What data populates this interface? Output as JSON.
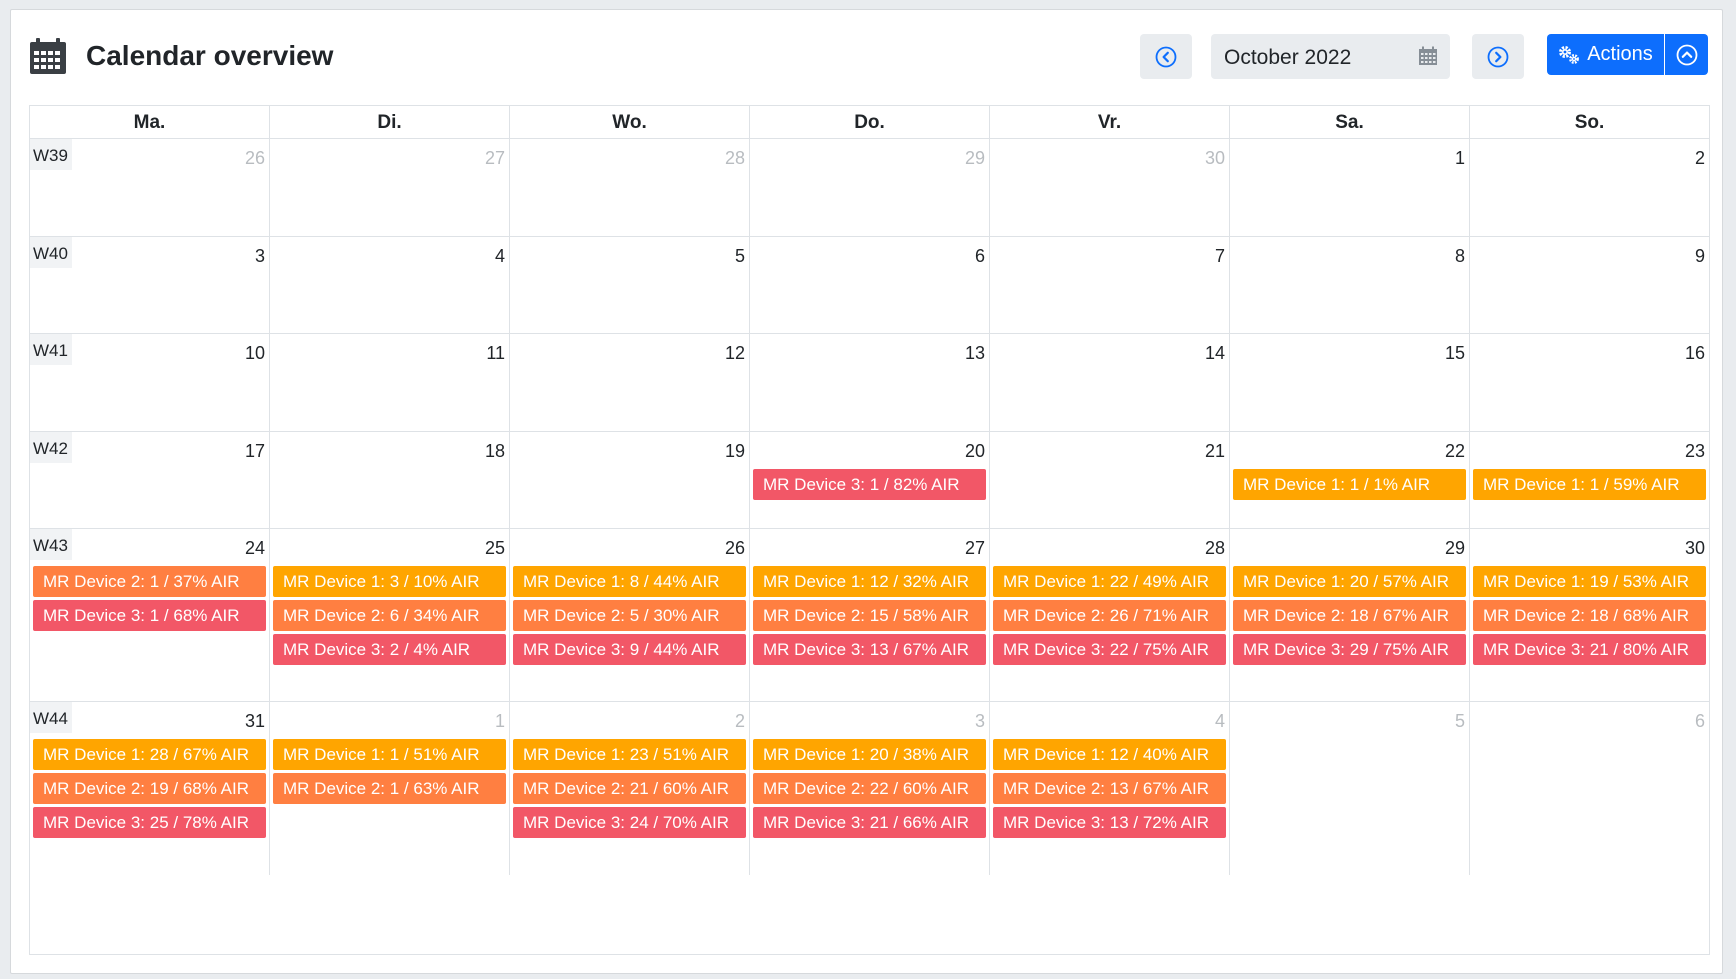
{
  "header": {
    "title": "Calendar overview",
    "month": "October 2022",
    "actions_label": "Actions",
    "icons": {
      "title": "calendar-icon",
      "prev": "chevron-left-circle-icon",
      "next": "chevron-right-circle-icon",
      "month_picker": "calendar-grid-icon",
      "actions": "gears-icon",
      "toggle": "chevron-up-circle-icon"
    }
  },
  "colors": {
    "device1": "#ffa500",
    "device2": "#ff7f41",
    "device3": "#f25767",
    "accent": "#0d6efd"
  },
  "days": [
    "Ma.",
    "Di.",
    "Wo.",
    "Do.",
    "Vr.",
    "Sa.",
    "So."
  ],
  "weeks": [
    {
      "label": "W39",
      "days": [
        {
          "num": "26",
          "muted": true,
          "events": []
        },
        {
          "num": "27",
          "muted": true,
          "events": []
        },
        {
          "num": "28",
          "muted": true,
          "events": []
        },
        {
          "num": "29",
          "muted": true,
          "events": []
        },
        {
          "num": "30",
          "muted": true,
          "events": []
        },
        {
          "num": "1",
          "muted": false,
          "events": []
        },
        {
          "num": "2",
          "muted": false,
          "events": []
        }
      ]
    },
    {
      "label": "W40",
      "days": [
        {
          "num": "3",
          "muted": false,
          "events": []
        },
        {
          "num": "4",
          "muted": false,
          "events": []
        },
        {
          "num": "5",
          "muted": false,
          "events": []
        },
        {
          "num": "6",
          "muted": false,
          "events": []
        },
        {
          "num": "7",
          "muted": false,
          "events": []
        },
        {
          "num": "8",
          "muted": false,
          "events": []
        },
        {
          "num": "9",
          "muted": false,
          "events": []
        }
      ]
    },
    {
      "label": "W41",
      "days": [
        {
          "num": "10",
          "muted": false,
          "events": []
        },
        {
          "num": "11",
          "muted": false,
          "events": []
        },
        {
          "num": "12",
          "muted": false,
          "events": []
        },
        {
          "num": "13",
          "muted": false,
          "events": []
        },
        {
          "num": "14",
          "muted": false,
          "events": []
        },
        {
          "num": "15",
          "muted": false,
          "events": []
        },
        {
          "num": "16",
          "muted": false,
          "events": []
        }
      ]
    },
    {
      "label": "W42",
      "days": [
        {
          "num": "17",
          "muted": false,
          "events": []
        },
        {
          "num": "18",
          "muted": false,
          "events": []
        },
        {
          "num": "19",
          "muted": false,
          "events": []
        },
        {
          "num": "20",
          "muted": false,
          "events": [
            {
              "device": 3,
              "label": "MR Device 3: 1 / 82% AIR"
            }
          ]
        },
        {
          "num": "21",
          "muted": false,
          "events": []
        },
        {
          "num": "22",
          "muted": false,
          "events": [
            {
              "device": 1,
              "label": "MR Device 1: 1 / 1% AIR"
            }
          ]
        },
        {
          "num": "23",
          "muted": false,
          "events": [
            {
              "device": 1,
              "label": "MR Device 1: 1 / 59% AIR"
            }
          ]
        }
      ]
    },
    {
      "label": "W43",
      "days": [
        {
          "num": "24",
          "muted": false,
          "events": [
            {
              "device": 2,
              "label": "MR Device 2: 1 / 37% AIR"
            },
            {
              "device": 3,
              "label": "MR Device 3: 1 / 68% AIR"
            }
          ]
        },
        {
          "num": "25",
          "muted": false,
          "events": [
            {
              "device": 1,
              "label": "MR Device 1: 3 / 10% AIR"
            },
            {
              "device": 2,
              "label": "MR Device 2: 6 / 34% AIR"
            },
            {
              "device": 3,
              "label": "MR Device 3: 2 / 4% AIR"
            }
          ]
        },
        {
          "num": "26",
          "muted": false,
          "events": [
            {
              "device": 1,
              "label": "MR Device 1: 8 / 44% AIR"
            },
            {
              "device": 2,
              "label": "MR Device 2: 5 / 30% AIR"
            },
            {
              "device": 3,
              "label": "MR Device 3: 9 / 44% AIR"
            }
          ]
        },
        {
          "num": "27",
          "muted": false,
          "events": [
            {
              "device": 1,
              "label": "MR Device 1: 12 / 32% AIR"
            },
            {
              "device": 2,
              "label": "MR Device 2: 15 / 58% AIR"
            },
            {
              "device": 3,
              "label": "MR Device 3: 13 / 67% AIR"
            }
          ]
        },
        {
          "num": "28",
          "muted": false,
          "events": [
            {
              "device": 1,
              "label": "MR Device 1: 22 / 49% AIR"
            },
            {
              "device": 2,
              "label": "MR Device 2: 26 / 71% AIR"
            },
            {
              "device": 3,
              "label": "MR Device 3: 22 / 75% AIR"
            }
          ]
        },
        {
          "num": "29",
          "muted": false,
          "events": [
            {
              "device": 1,
              "label": "MR Device 1: 20 / 57% AIR"
            },
            {
              "device": 2,
              "label": "MR Device 2: 18 / 67% AIR"
            },
            {
              "device": 3,
              "label": "MR Device 3: 29 / 75% AIR"
            }
          ]
        },
        {
          "num": "30",
          "muted": false,
          "events": [
            {
              "device": 1,
              "label": "MR Device 1: 19 / 53% AIR"
            },
            {
              "device": 2,
              "label": "MR Device 2: 18 / 68% AIR"
            },
            {
              "device": 3,
              "label": "MR Device 3: 21 / 80% AIR"
            }
          ]
        }
      ]
    },
    {
      "label": "W44",
      "days": [
        {
          "num": "31",
          "muted": false,
          "events": [
            {
              "device": 1,
              "label": "MR Device 1: 28 / 67% AIR"
            },
            {
              "device": 2,
              "label": "MR Device 2: 19 / 68% AIR"
            },
            {
              "device": 3,
              "label": "MR Device 3: 25 / 78% AIR"
            }
          ]
        },
        {
          "num": "1",
          "muted": true,
          "events": [
            {
              "device": 1,
              "label": "MR Device 1: 1 / 51% AIR"
            },
            {
              "device": 2,
              "label": "MR Device 2: 1 / 63% AIR"
            }
          ]
        },
        {
          "num": "2",
          "muted": true,
          "events": [
            {
              "device": 1,
              "label": "MR Device 1: 23 / 51% AIR"
            },
            {
              "device": 2,
              "label": "MR Device 2: 21 / 60% AIR"
            },
            {
              "device": 3,
              "label": "MR Device 3: 24 / 70% AIR"
            }
          ]
        },
        {
          "num": "3",
          "muted": true,
          "events": [
            {
              "device": 1,
              "label": "MR Device 1: 20 / 38% AIR"
            },
            {
              "device": 2,
              "label": "MR Device 2: 22 / 60% AIR"
            },
            {
              "device": 3,
              "label": "MR Device 3: 21 / 66% AIR"
            }
          ]
        },
        {
          "num": "4",
          "muted": true,
          "events": [
            {
              "device": 1,
              "label": "MR Device 1: 12 / 40% AIR"
            },
            {
              "device": 2,
              "label": "MR Device 2: 13 / 67% AIR"
            },
            {
              "device": 3,
              "label": "MR Device 3: 13 / 72% AIR"
            }
          ]
        },
        {
          "num": "5",
          "muted": true,
          "events": []
        },
        {
          "num": "6",
          "muted": true,
          "events": []
        }
      ]
    }
  ]
}
